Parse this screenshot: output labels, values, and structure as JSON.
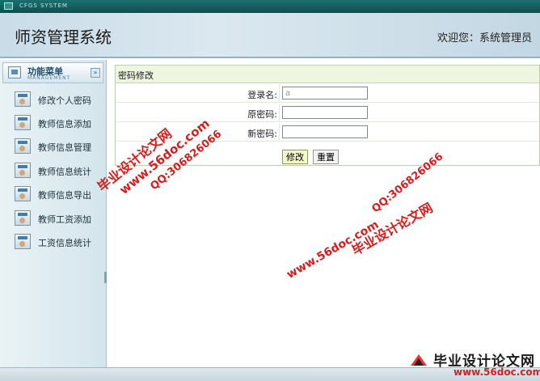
{
  "topbar": {
    "system_code": "CFGS SYSTEM"
  },
  "header": {
    "title": "师资管理系统",
    "welcome": "欢迎您：系统管理员"
  },
  "sidebar": {
    "menu_title": "功能菜单",
    "menu_subtitle": "MANAGEMENT",
    "collapse_glyph": "»",
    "items": [
      {
        "label": "修改个人密码",
        "icon": "user-card-icon"
      },
      {
        "label": "教师信息添加",
        "icon": "user-card-icon"
      },
      {
        "label": "教师信息管理",
        "icon": "user-card-icon"
      },
      {
        "label": "教师信息统计",
        "icon": "user-card-icon"
      },
      {
        "label": "教师信息导出",
        "icon": "user-card-icon"
      },
      {
        "label": "教师工资添加",
        "icon": "user-card-icon"
      },
      {
        "label": "工资信息统计",
        "icon": "user-card-icon"
      }
    ]
  },
  "form": {
    "panel_title": "密码修改",
    "fields": [
      {
        "label": "登录名:",
        "value": "a"
      },
      {
        "label": "原密码:",
        "value": ""
      },
      {
        "label": "新密码:",
        "value": ""
      }
    ],
    "submit_label": "修改",
    "reset_label": "重置"
  },
  "watermarks": {
    "cn": "毕业设计论文网",
    "url": "www.56doc.com",
    "qq": "QQ:306826066"
  },
  "stamp": {
    "cn": "毕业设计论文网",
    "url": "www.56doc.com"
  },
  "colors": {
    "topbar": "#0f4e50",
    "panel_header": "#eef6df",
    "watermark": "#d61d1d"
  }
}
